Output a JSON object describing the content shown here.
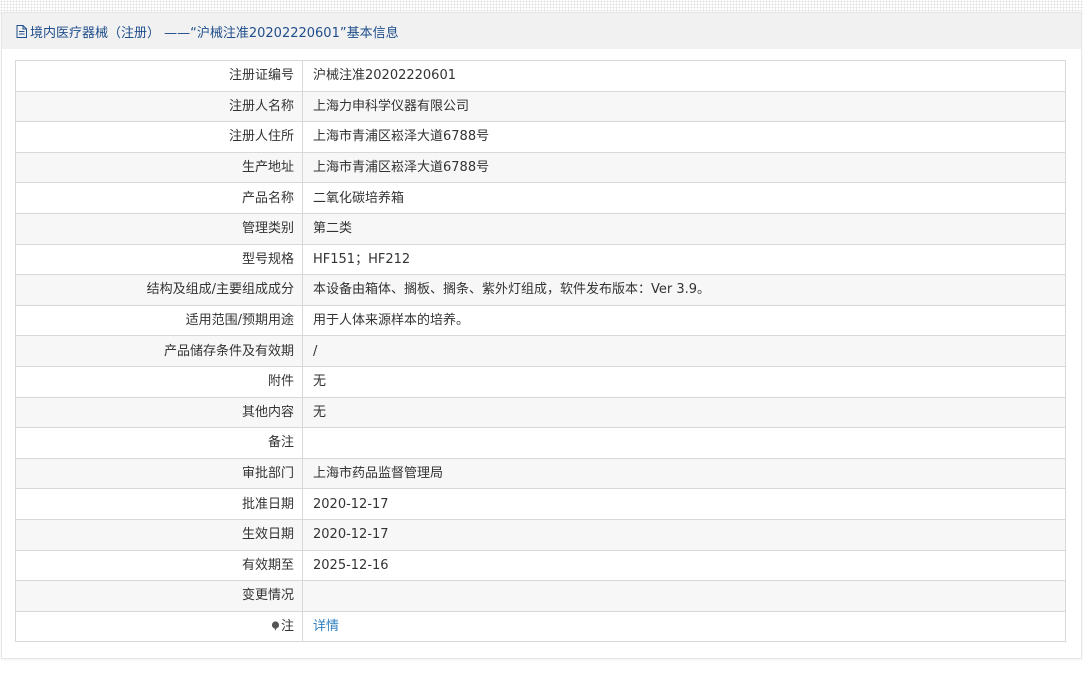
{
  "header": {
    "title": "境内医疗器械（注册） ——“沪械注准20202220601”基本信息",
    "icon": "document-icon"
  },
  "rows": [
    {
      "label": "注册证编号",
      "value": "沪械注准20202220601"
    },
    {
      "label": "注册人名称",
      "value": "上海力申科学仪器有限公司"
    },
    {
      "label": "注册人住所",
      "value": "上海市青浦区崧泽大道6788号"
    },
    {
      "label": "生产地址",
      "value": "上海市青浦区崧泽大道6788号"
    },
    {
      "label": "产品名称",
      "value": "二氧化碳培养箱"
    },
    {
      "label": "管理类别",
      "value": "第二类"
    },
    {
      "label": "型号规格",
      "value": "HF151；HF212"
    },
    {
      "label": "结构及组成/主要组成成分",
      "value": "本设备由箱体、搁板、搁条、紫外灯组成，软件发布版本：Ver 3.9。"
    },
    {
      "label": "适用范围/预期用途",
      "value": "用于人体来源样本的培养。"
    },
    {
      "label": "产品储存条件及有效期",
      "value": "/"
    },
    {
      "label": "附件",
      "value": "无"
    },
    {
      "label": "其他内容",
      "value": "无"
    },
    {
      "label": "备注",
      "value": ""
    },
    {
      "label": "审批部门",
      "value": "上海市药品监督管理局"
    },
    {
      "label": "批准日期",
      "value": "2020-12-17"
    },
    {
      "label": "生效日期",
      "value": "2020-12-17"
    },
    {
      "label": "有效期至",
      "value": "2025-12-16"
    },
    {
      "label": "变更情况",
      "value": ""
    }
  ],
  "note": {
    "label": "注",
    "icon": "pin-icon",
    "link": "详情"
  }
}
